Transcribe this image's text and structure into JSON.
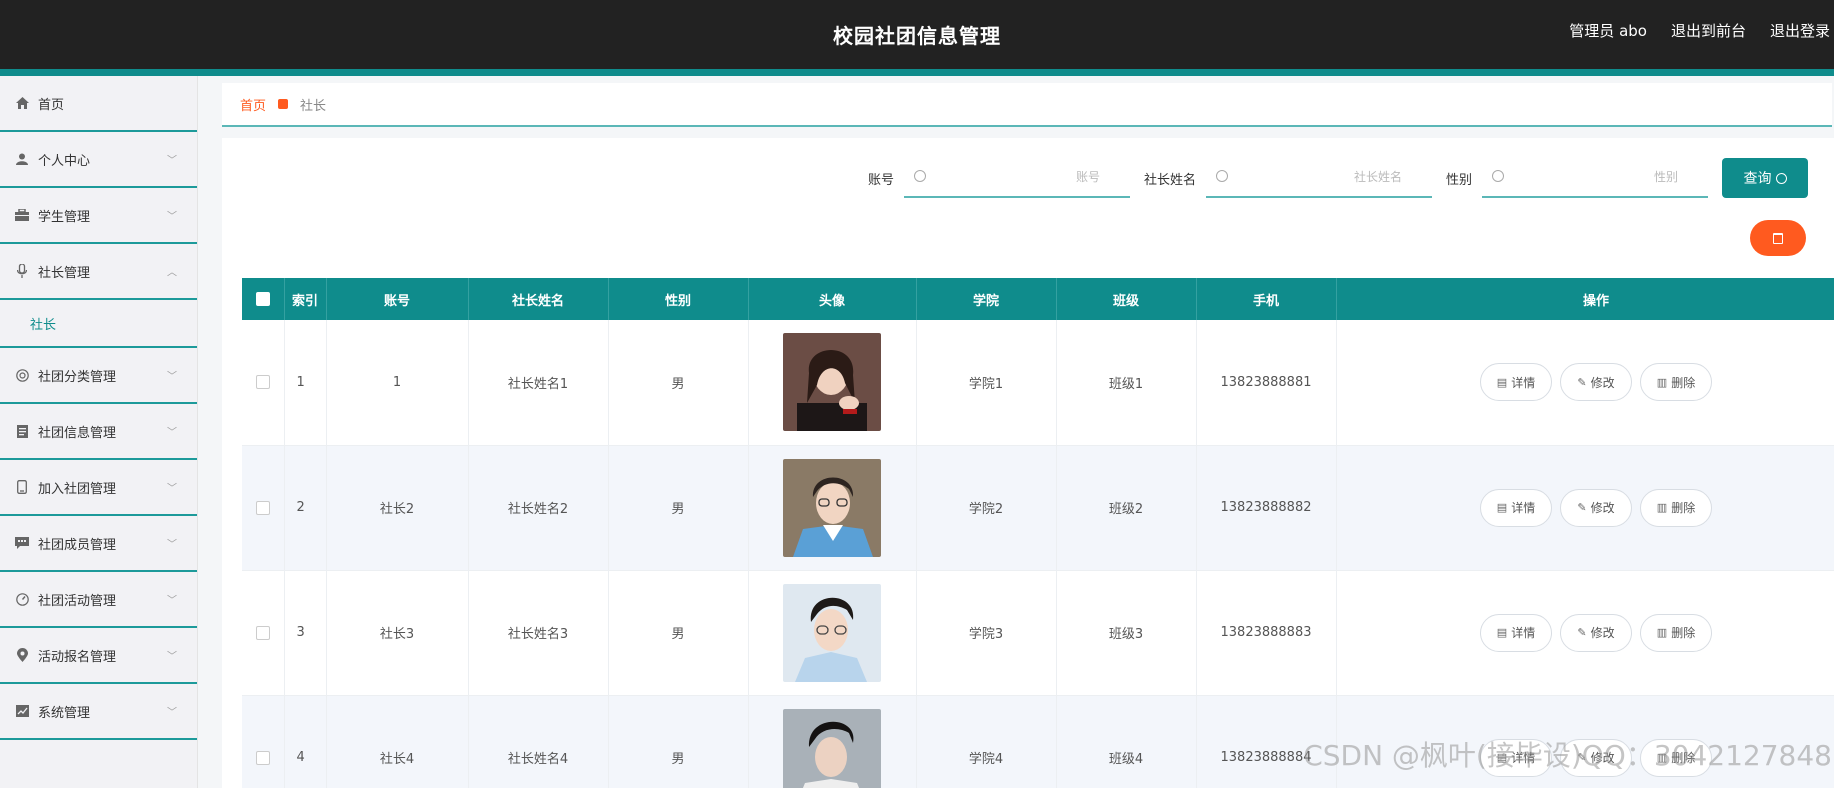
{
  "header": {
    "title": "校园社团信息管理",
    "user": "管理员 abo",
    "to_front": "退出到前台",
    "logout": "退出登录"
  },
  "sidebar": {
    "items": [
      {
        "label": "首页",
        "icon": "home-icon",
        "chevron": ""
      },
      {
        "label": "个人中心",
        "icon": "user-icon",
        "chevron": "down"
      },
      {
        "label": "学生管理",
        "icon": "briefcase-icon",
        "chevron": "down"
      },
      {
        "label": "社长管理",
        "icon": "microphone-icon",
        "chevron": "up",
        "expanded": true,
        "sub": [
          "社长"
        ]
      },
      {
        "label": "社团分类管理",
        "icon": "globe-icon",
        "chevron": "down"
      },
      {
        "label": "社团信息管理",
        "icon": "document-icon",
        "chevron": "down"
      },
      {
        "label": "加入社团管理",
        "icon": "phone-icon",
        "chevron": "down"
      },
      {
        "label": "社团成员管理",
        "icon": "chat-icon",
        "chevron": "down"
      },
      {
        "label": "社团活动管理",
        "icon": "gauge-icon",
        "chevron": "down"
      },
      {
        "label": "活动报名管理",
        "icon": "location-icon",
        "chevron": "down"
      },
      {
        "label": "系统管理",
        "icon": "chart-icon",
        "chevron": "down"
      }
    ]
  },
  "breadcrumb": {
    "home": "首页",
    "current": "社长"
  },
  "search": {
    "fields": [
      {
        "label": "账号",
        "placeholder": "账号"
      },
      {
        "label": "社长姓名",
        "placeholder": "社长姓名"
      },
      {
        "label": "性别",
        "placeholder": "性别"
      }
    ],
    "button": "查询"
  },
  "table": {
    "columns": [
      "索引",
      "账号",
      "社长姓名",
      "性别",
      "头像",
      "学院",
      "班级",
      "手机",
      "操作"
    ],
    "actions": {
      "detail": "详情",
      "edit": "修改",
      "delete": "删除"
    },
    "rows": [
      {
        "index": "1",
        "account": "1",
        "name": "社长姓名1",
        "gender": "男",
        "college": "学院1",
        "class": "班级1",
        "phone": "13823888881"
      },
      {
        "index": "2",
        "account": "社长2",
        "name": "社长姓名2",
        "gender": "男",
        "college": "学院2",
        "class": "班级2",
        "phone": "13823888882"
      },
      {
        "index": "3",
        "account": "社长3",
        "name": "社长姓名3",
        "gender": "男",
        "college": "学院3",
        "class": "班级3",
        "phone": "13823888883"
      },
      {
        "index": "4",
        "account": "社长4",
        "name": "社长姓名4",
        "gender": "男",
        "college": "学院4",
        "class": "班级4",
        "phone": "13823888884"
      }
    ]
  },
  "watermark": "CSDN @枫叶(接毕设)QQ：3042127848",
  "colors": {
    "primary": "#0f8c8c",
    "accent": "#ff5a1f",
    "header": "#222222"
  }
}
